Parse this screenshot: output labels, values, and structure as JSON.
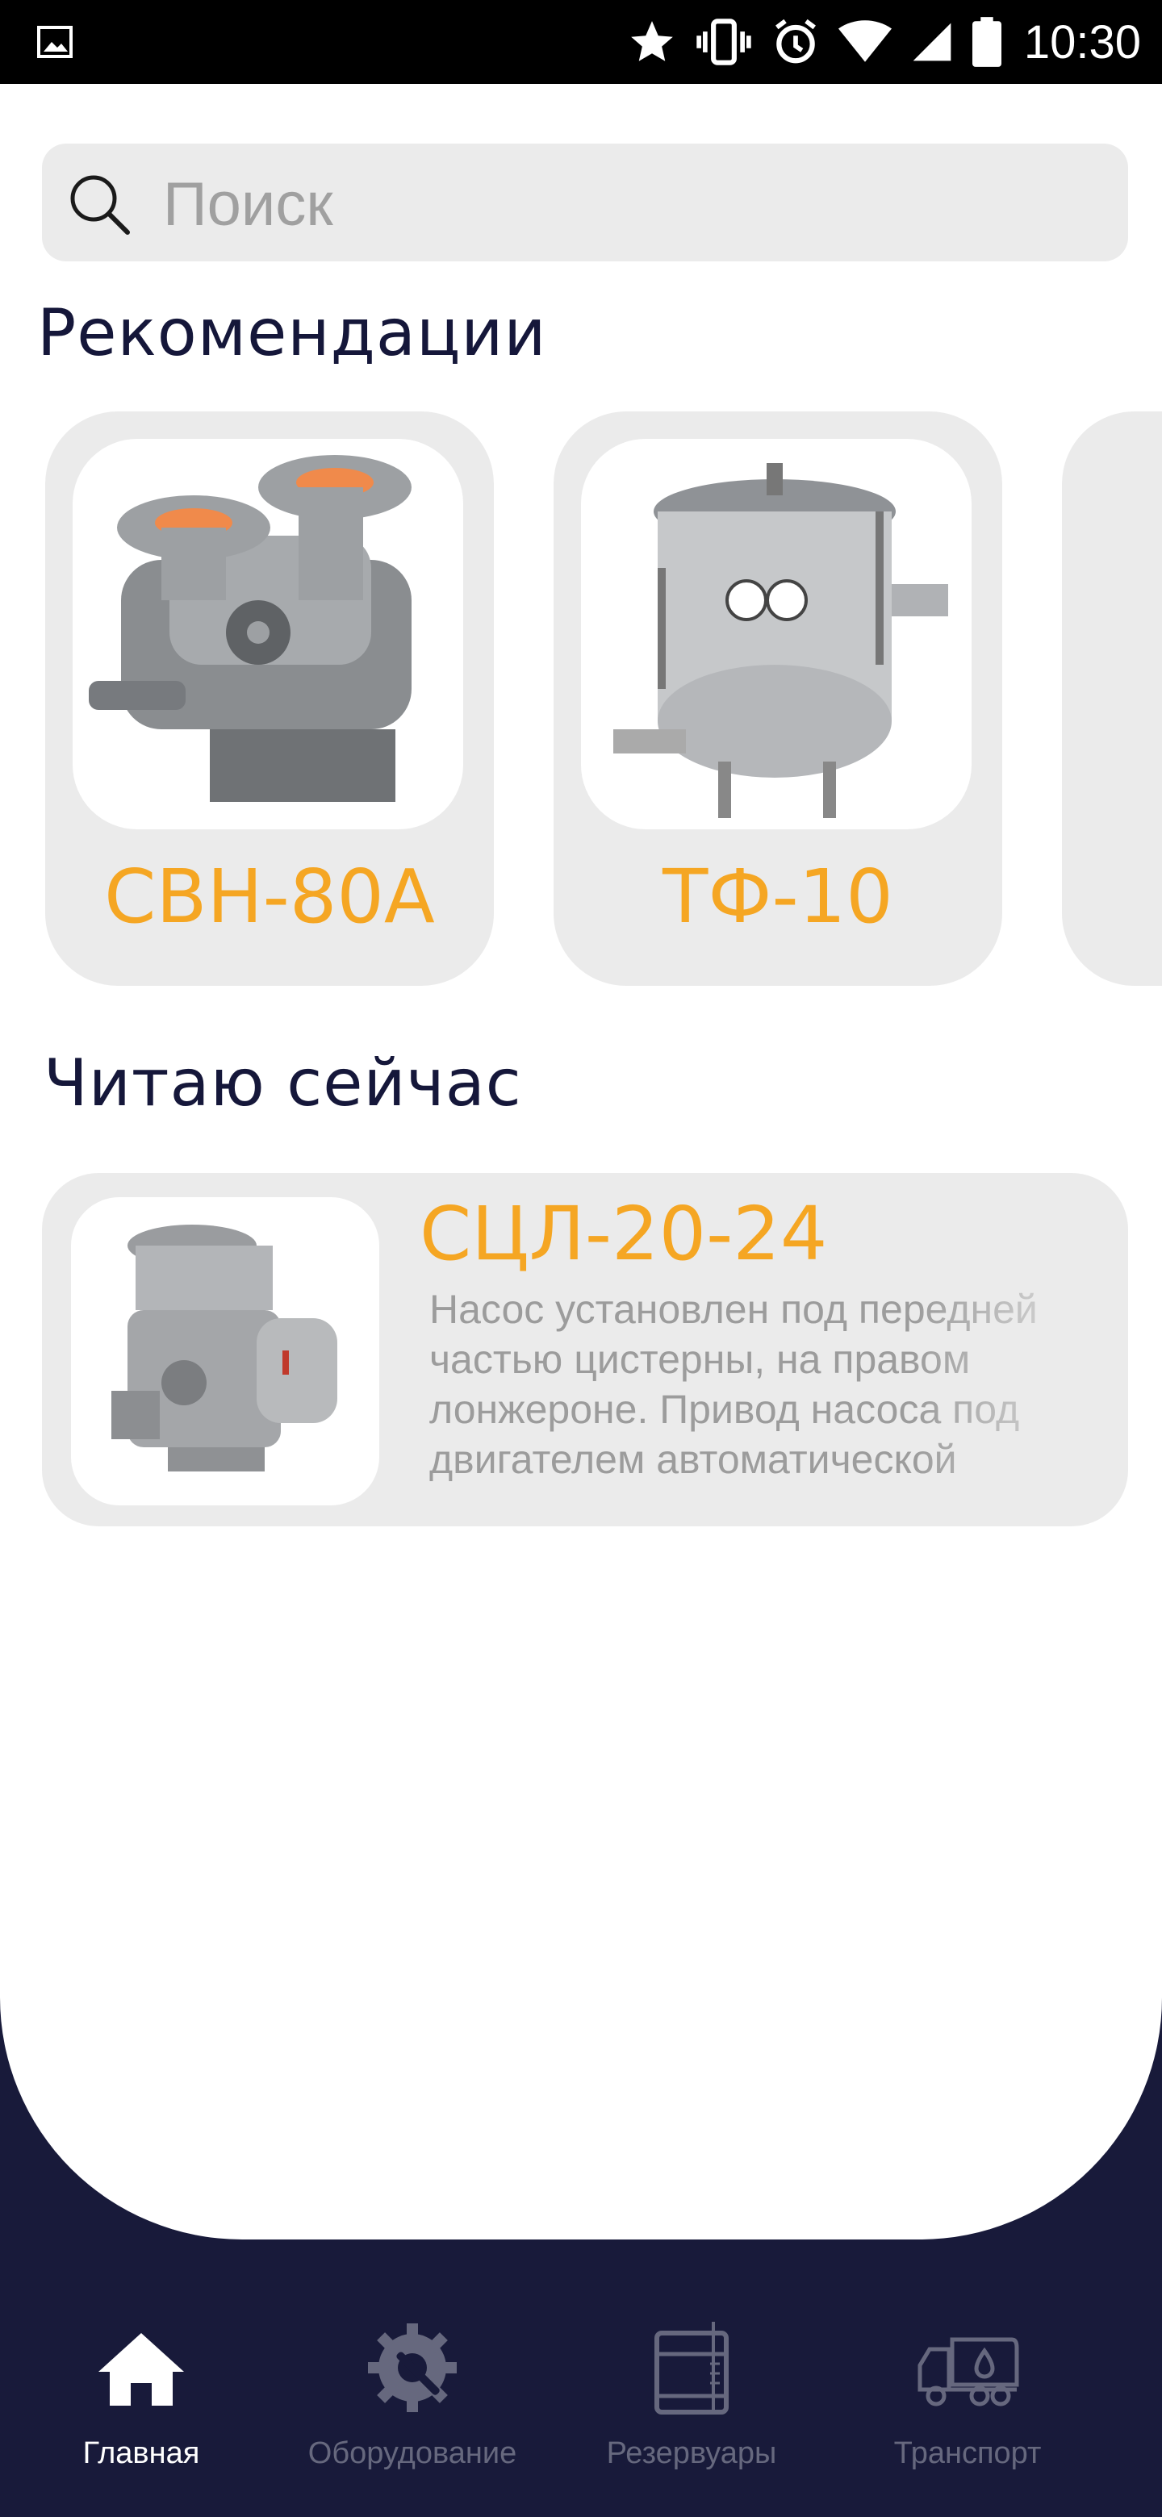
{
  "status_bar": {
    "time": "10:30",
    "icons": [
      "image-icon",
      "star-icon",
      "vibrate-icon",
      "alarm-icon",
      "wifi-icon",
      "signal-icon",
      "battery-icon"
    ]
  },
  "search": {
    "placeholder": "Поиск",
    "value": ""
  },
  "recommendations": {
    "title": "Рекомендации",
    "items": [
      {
        "name": "СВН-80А",
        "image": "pump-image"
      },
      {
        "name": "ТФ-10",
        "image": "filter-tank-image"
      }
    ]
  },
  "reading": {
    "title": "Читаю сейчас",
    "item": {
      "name": "СЦЛ-20-24",
      "description": "Насос установлен под передней частью цистерны, на правом лонжероне. Привод насоса под двигателем автоматической",
      "image": "pump-image"
    }
  },
  "bottom_nav": {
    "items": [
      {
        "label": "Главная",
        "icon": "home-icon",
        "active": true
      },
      {
        "label": "Оборудование",
        "icon": "gear-wrench-icon",
        "active": false
      },
      {
        "label": "Резервуары",
        "icon": "tank-icon",
        "active": false
      },
      {
        "label": "Транспорт",
        "icon": "truck-icon",
        "active": false
      }
    ]
  },
  "colors": {
    "accent": "#f5a623",
    "nav_background": "#181a3a",
    "card_background": "#ebebeb",
    "title_text": "#15173a"
  }
}
